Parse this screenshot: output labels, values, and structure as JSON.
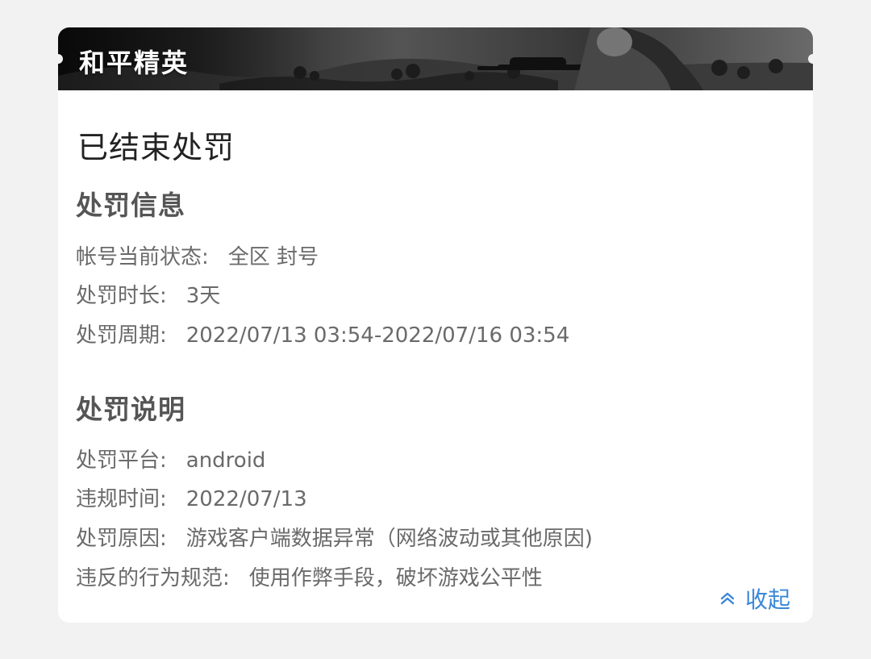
{
  "banner": {
    "game_title": "和平精英"
  },
  "status": "已结束处罚",
  "penalty_info": {
    "title": "处罚信息",
    "rows": [
      {
        "label": "帐号当前状态:",
        "value": "全区 封号"
      },
      {
        "label": "处罚时长:",
        "value": "3天"
      },
      {
        "label": "处罚周期:",
        "value": "2022/07/13 03:54-2022/07/16 03:54"
      }
    ]
  },
  "penalty_explain": {
    "title": "处罚说明",
    "rows": [
      {
        "label": "处罚平台:",
        "value": "android"
      },
      {
        "label": "违规时间:",
        "value": "2022/07/13"
      },
      {
        "label": "处罚原因:",
        "value": "游戏客户端数据异常（网络波动或其他原因)"
      },
      {
        "label": "违反的行为规范:",
        "value": "使用作弊手段，破坏游戏公平性"
      }
    ]
  },
  "collapse": {
    "label": "收起",
    "icon": "double-chevron-up-icon"
  },
  "colors": {
    "accent": "#3a87d9",
    "page_bg": "#f2f2f2",
    "card_bg": "#ffffff"
  }
}
